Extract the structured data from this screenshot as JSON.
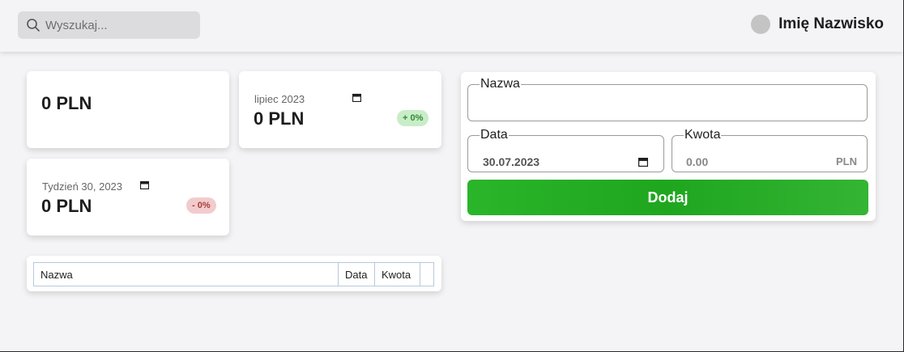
{
  "search": {
    "placeholder": "Wyszukaj..."
  },
  "user": {
    "name": "Imię Nazwisko"
  },
  "summary": {
    "total": {
      "amount": "0 PLN"
    },
    "month": {
      "period": "lipiec 2023",
      "amount": "0 PLN",
      "change": "+ 0%"
    },
    "week": {
      "period": "Tydzień 30, 2023",
      "amount": "0 PLN",
      "change": "- 0%"
    }
  },
  "table": {
    "columns": [
      "Nazwa",
      "Data",
      "Kwota",
      ""
    ]
  },
  "form": {
    "name_label": "Nazwa",
    "name_value": "",
    "date_label": "Data",
    "date_value": "30.07.2023",
    "amount_label": "Kwota",
    "amount_value": "0.00",
    "currency": "PLN",
    "submit_label": "Dodaj"
  },
  "colors": {
    "accent": "#24ad24",
    "up_badge": "#c9ecc9",
    "down_badge": "#f2cccc"
  }
}
